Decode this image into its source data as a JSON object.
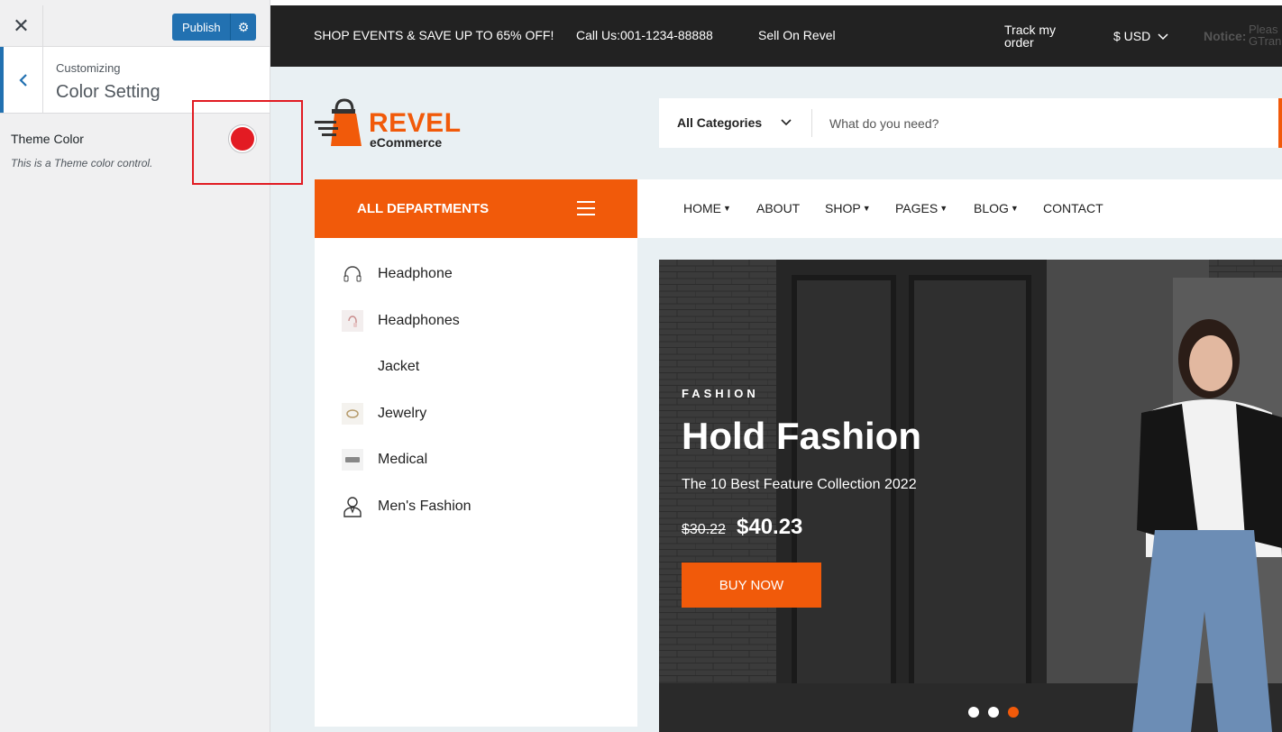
{
  "customizer": {
    "close_icon": "close-icon",
    "publish_label": "Publish",
    "settings_icon": "gear-icon",
    "back_icon": "chevron-left-icon",
    "eyebrow": "Customizing",
    "section_title": "Color Setting",
    "control": {
      "label": "Theme Color",
      "description": "This is a Theme color control.",
      "value_color": "#e31b23"
    }
  },
  "topbar": {
    "promo": "SHOP EVENTS & SAVE UP TO 65% OFF!",
    "call": "Call Us:001-1234-88888",
    "sell": "Sell On Revel",
    "track_line1": "Track my",
    "track_line2": "order",
    "currency": "$ USD",
    "notice_label": "Notice:",
    "notice_line1": "Pleas",
    "notice_line2": "GTran"
  },
  "logo": {
    "name": "REVEL",
    "sub": "eCommerce"
  },
  "search": {
    "category": "All Categories",
    "placeholder": "What do you need?"
  },
  "departments": {
    "label": "ALL DEPARTMENTS",
    "items": [
      {
        "label": "Headphone",
        "icon": "headphone-icon"
      },
      {
        "label": "Headphones",
        "icon": "headphones-thumb-icon"
      },
      {
        "label": "Jacket",
        "icon": ""
      },
      {
        "label": "Jewelry",
        "icon": "jewelry-thumb-icon"
      },
      {
        "label": "Medical",
        "icon": "medical-thumb-icon"
      },
      {
        "label": "Men's Fashion",
        "icon": "man-icon"
      }
    ]
  },
  "nav": [
    {
      "label": "HOME",
      "dropdown": true
    },
    {
      "label": "ABOUT",
      "dropdown": false
    },
    {
      "label": "SHOP",
      "dropdown": true
    },
    {
      "label": "PAGES",
      "dropdown": true
    },
    {
      "label": "BLOG",
      "dropdown": true
    },
    {
      "label": "CONTACT",
      "dropdown": false
    }
  ],
  "hero": {
    "eyebrow": "FASHION",
    "title": "Hold Fashion",
    "subtitle": "The 10 Best Feature Collection 2022",
    "old_price": "$30.22",
    "price": "$40.23",
    "cta": "BUY NOW",
    "slides": 3,
    "active_slide": 3
  },
  "colors": {
    "accent": "#f15a0a",
    "wp_blue": "#2271b1",
    "topbar_bg": "#222222"
  }
}
